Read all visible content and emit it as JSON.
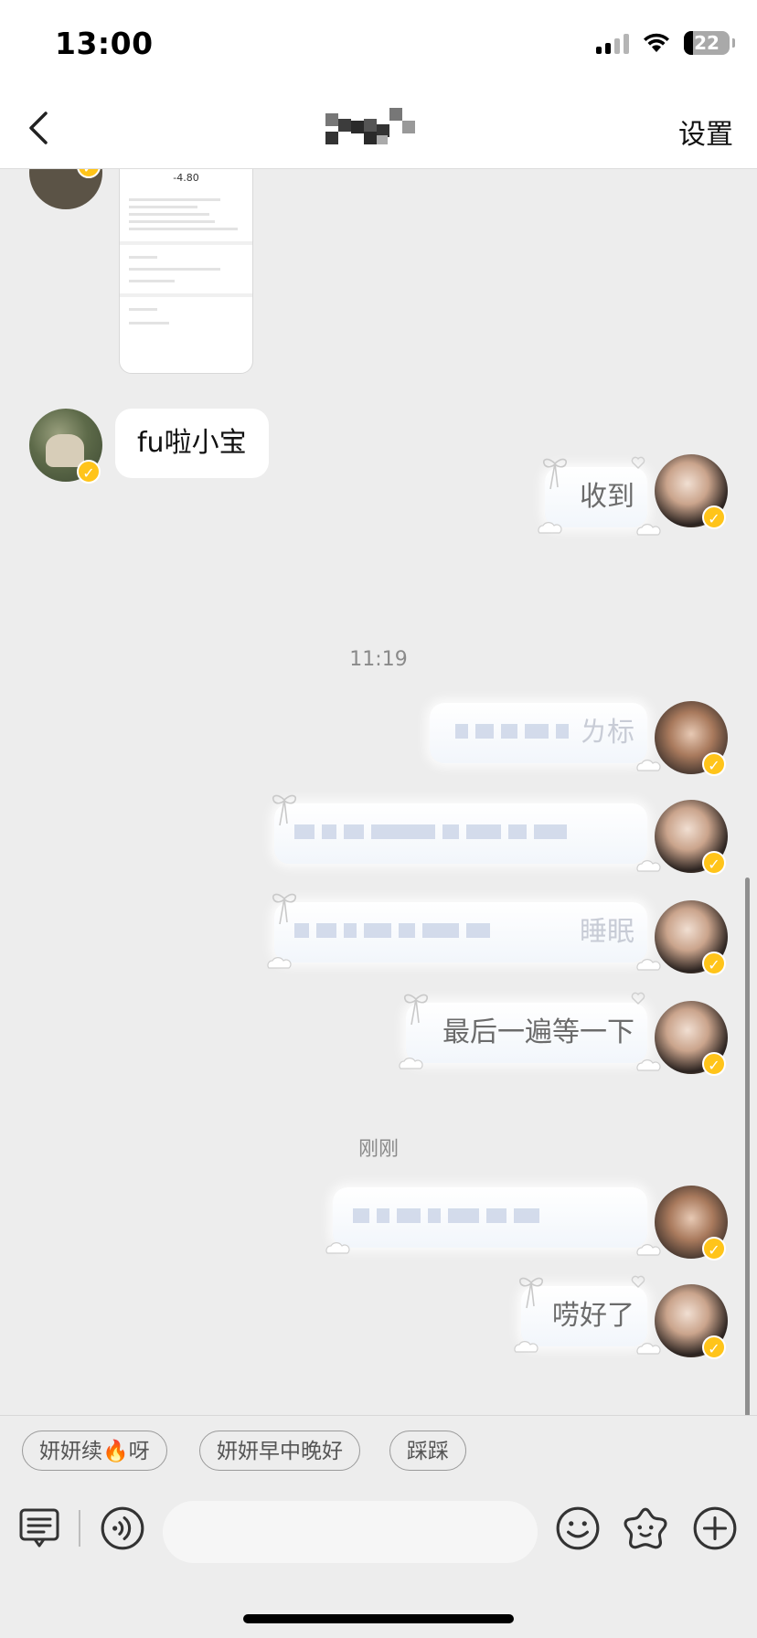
{
  "status_bar": {
    "time": "13:00",
    "battery": "22"
  },
  "nav": {
    "settings_label": "设置"
  },
  "messages": {
    "left_text": "fu啦小宝",
    "shot_amount": "-4.80",
    "timestamp_1": "11:19",
    "timestamp_2": "刚刚",
    "right_1": "收到",
    "right_2_tail": "ㄌ标",
    "right_4_tail": "睡眠",
    "right_5": "最后一遍等一下",
    "right_7": "唠好了"
  },
  "suggestions": [
    "妍妍续🔥呀",
    "妍妍早中晚好",
    "踩踩"
  ],
  "colors": {
    "verified_badge": "#ffc41a",
    "background": "#ededed",
    "bubble_text": "#6b6b6b"
  },
  "icons": [
    "back-icon",
    "signal-icon",
    "wifi-icon",
    "battery-icon",
    "verified-badge-icon",
    "menu-icon",
    "voice-icon",
    "emoji-icon",
    "sticker-icon",
    "plus-icon"
  ]
}
